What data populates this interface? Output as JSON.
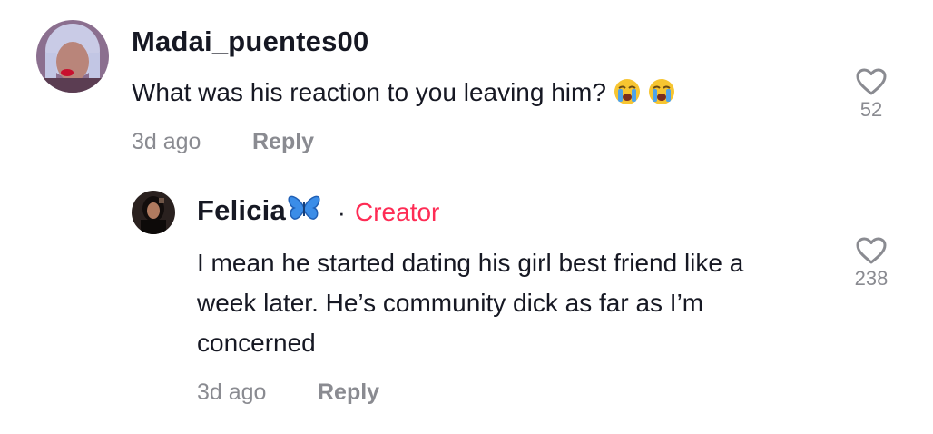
{
  "comment": {
    "username": "Madai_puentes00",
    "text": "What was his reaction to you leaving him?",
    "emojis": [
      "loudly-crying-face",
      "loudly-crying-face"
    ],
    "time": "3d ago",
    "reply_label": "Reply",
    "like_count": "52"
  },
  "reply": {
    "username": "Felicia",
    "username_emoji": "blue-butterfly",
    "separator": "·",
    "badge": "Creator",
    "text_lines": [
      "I mean he started dating his girl best friend like a",
      "week later. He’s community dick as far as I’m",
      "concerned"
    ],
    "time": "3d ago",
    "reply_label": "Reply",
    "like_count": "238"
  },
  "colors": {
    "text": "#161823",
    "secondary": "#8a8b91",
    "creator_accent": "#fe2c55",
    "butterfly": "#2b7de9"
  }
}
